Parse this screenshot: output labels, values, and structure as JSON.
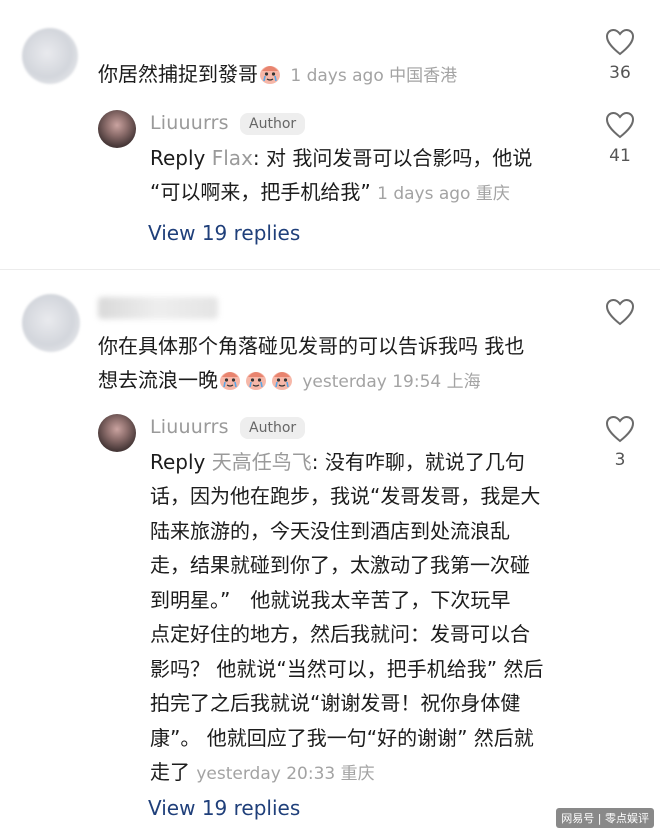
{
  "comments": [
    {
      "text_prefix": "你居然捕捉到發哥",
      "meta": "1 days ago 中国香港",
      "likes": "36",
      "reply": {
        "author": "Liuuurrs",
        "badge": "Author",
        "label": "Reply",
        "to": "Flax",
        "line1": ": 对 我问发哥可以合影吗，他说",
        "line2": "“可以啊来，把手机给我”",
        "meta": "1 days ago 重庆",
        "likes": "41"
      },
      "view_replies": "View 19 replies"
    },
    {
      "obscured_name": "天高任鸟飞",
      "text_line1": "你在具体那个角落碰见发哥的可以告诉我吗 我也",
      "text_line2": "想去流浪一晚",
      "meta": "yesterday 19:54 上海",
      "likes": "",
      "reply": {
        "author": "Liuuurrs",
        "badge": "Author",
        "label": "Reply",
        "to": "天高任鸟飞",
        "line1": ": 没有咋聊，就说了几句",
        "lines": [
          "话，因为他在跑步，我说“发哥发哥，我是大",
          "陆来旅游的，今天没住到酒店到处流浪乱",
          "走，结果就碰到你了，太激动了我第一次碰",
          "到明星。”　他就说我太辛苦了，下次玩早",
          "点定好住的地方，然后我就问：发哥可以合",
          "影吗？ 他就说“当然可以，把手机给我” 然后",
          "拍完了之后我就说“谢谢发哥！祝你身体健",
          "康”。 他就回应了我一句“好的谢谢” 然后就"
        ],
        "last_line": "走了",
        "meta": "yesterday 20:33 重庆",
        "likes": "3"
      },
      "view_replies": "View 19 replies"
    }
  ],
  "watermark": "网易号 | 零点娱评",
  "colors": {
    "link": "#1f3f7a",
    "meta": "#a3a3a3",
    "text": "#1c1c1c"
  }
}
